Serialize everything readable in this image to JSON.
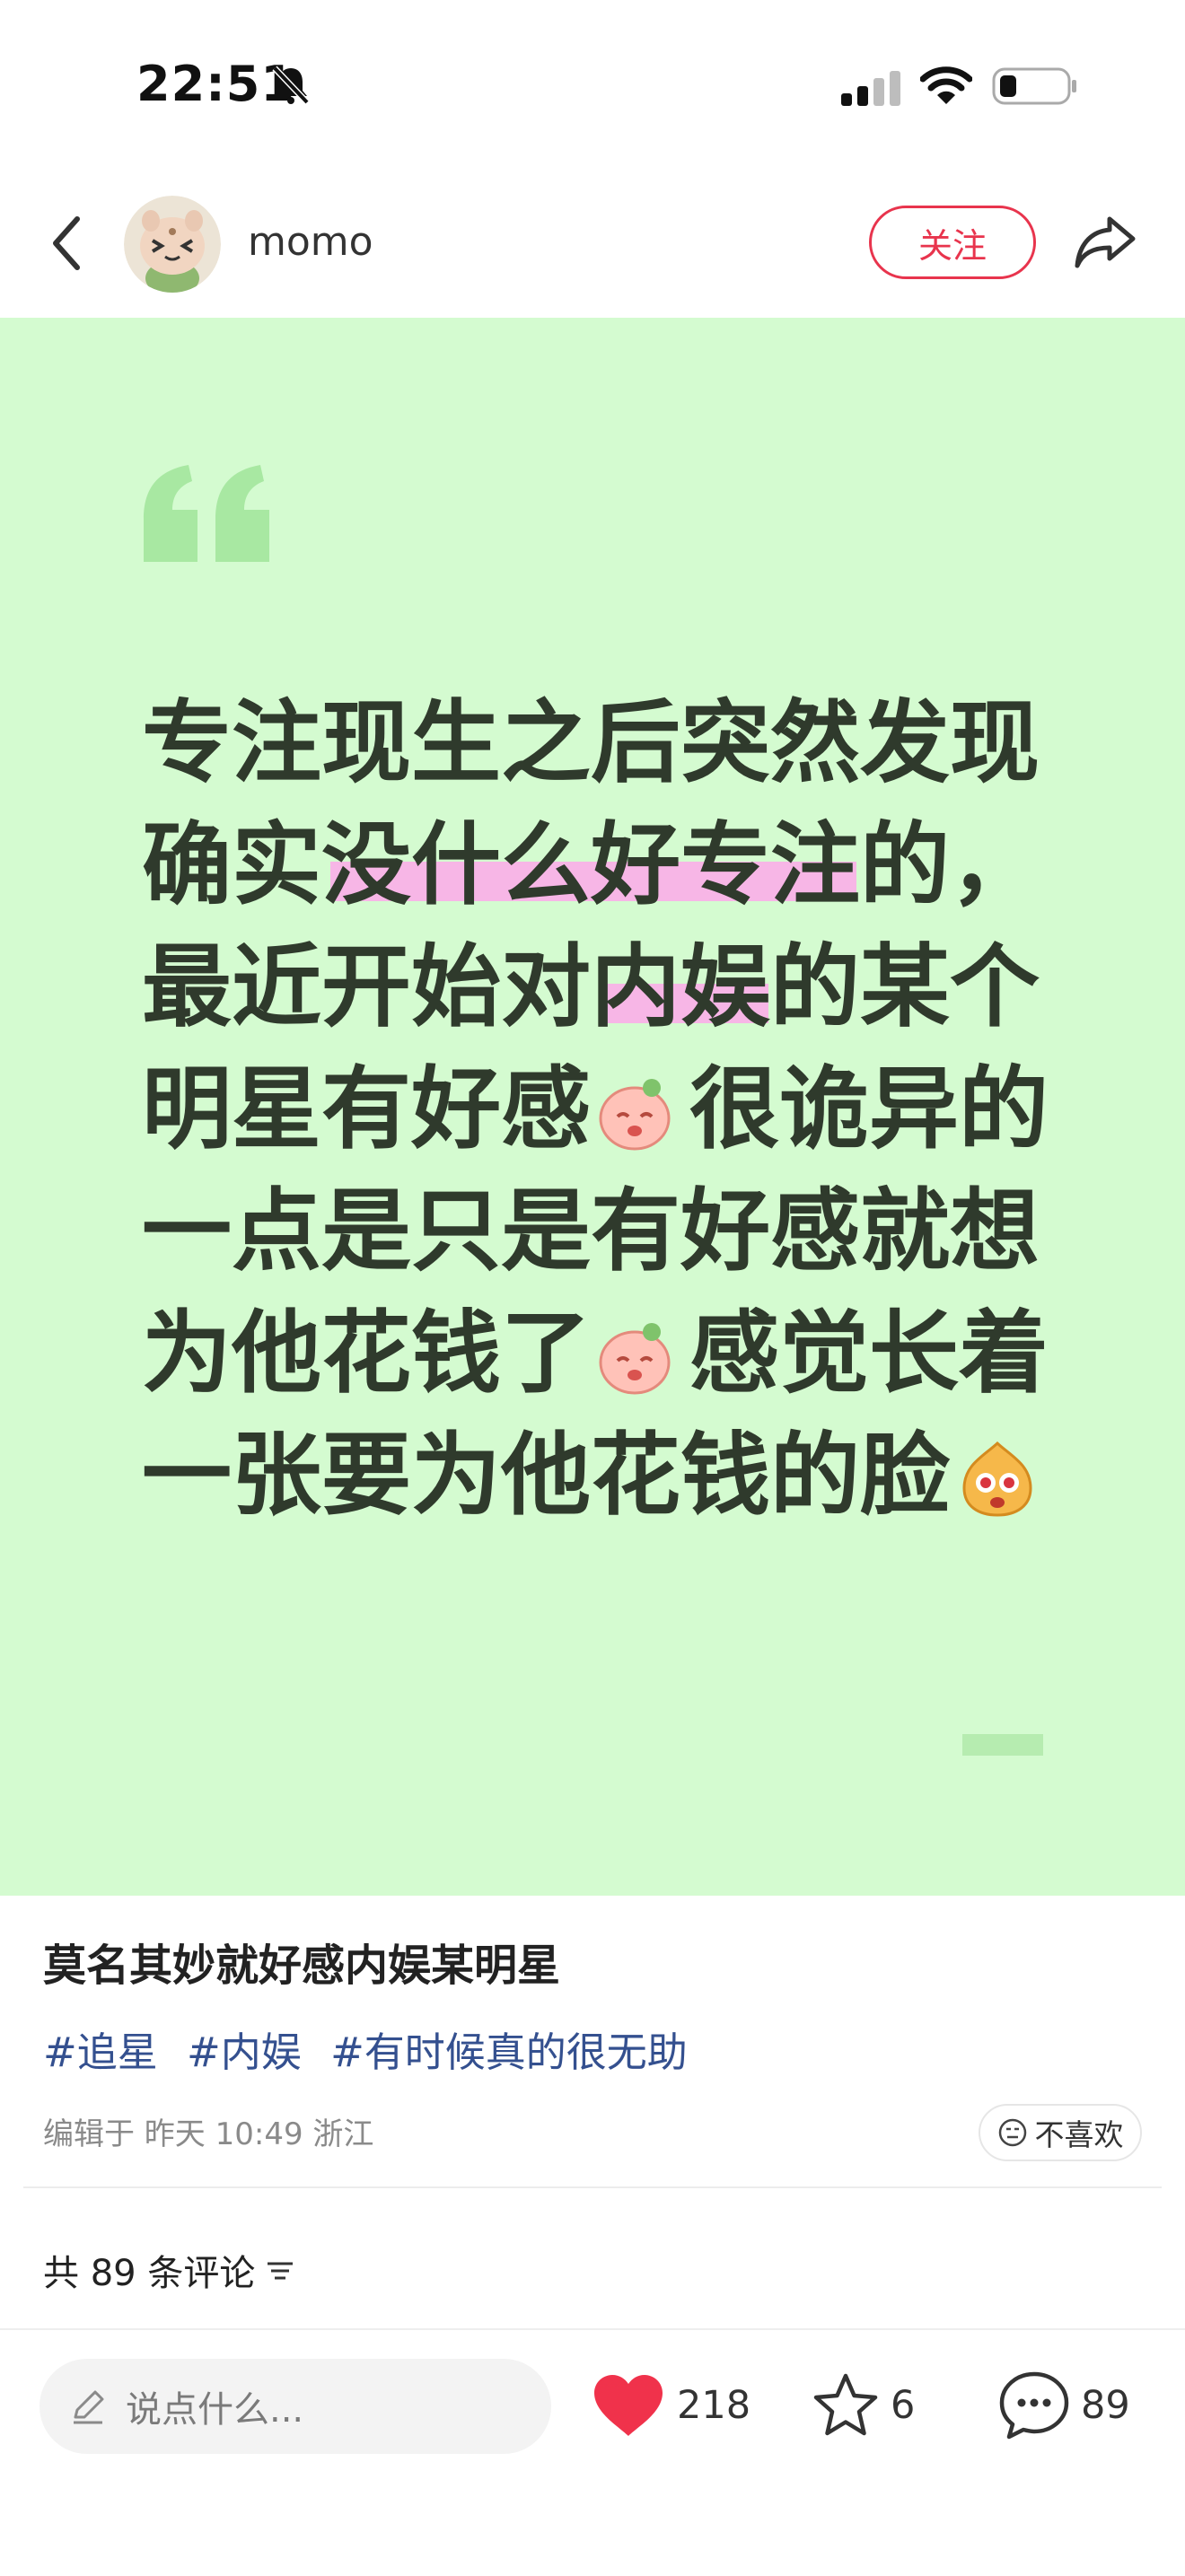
{
  "status_bar": {
    "time": "22:51"
  },
  "header": {
    "username": "momo",
    "follow_label": "关注"
  },
  "note_card": {
    "background": "#d4fbd0",
    "text": "专注现生之后突然发现确实没什么好专注的，最近开始对内娱的某个明星有好感很诡异的一点是只是有好感就想为他花钱了感觉长着一张要为他花钱的脸"
  },
  "note_lines": [
    "专注现生之后突然发现",
    "确实没什么好专注的，",
    "最近开始对内娱的某个",
    "明星有好感",
    "很诡异的",
    "一点是只是有好感就想",
    "为他花钱了",
    "感觉长着",
    "一张要为他花钱的脸"
  ],
  "post": {
    "title": "莫名其妙就好感内娱某明星",
    "tags": [
      "#追星",
      "#内娱",
      "#有时候真的很无助"
    ],
    "edit_info": "编辑于 昨天 10:49 浙江",
    "dislike_label": "不喜欢",
    "comment_count_label": "共 89 条评论"
  },
  "bottom_bar": {
    "input_placeholder": "说点什么...",
    "likes": "218",
    "stars": "6",
    "comments": "89"
  },
  "colors": {
    "accent": "#e8344d",
    "tag": "#34508f",
    "highlight": "#f7b6e6"
  }
}
